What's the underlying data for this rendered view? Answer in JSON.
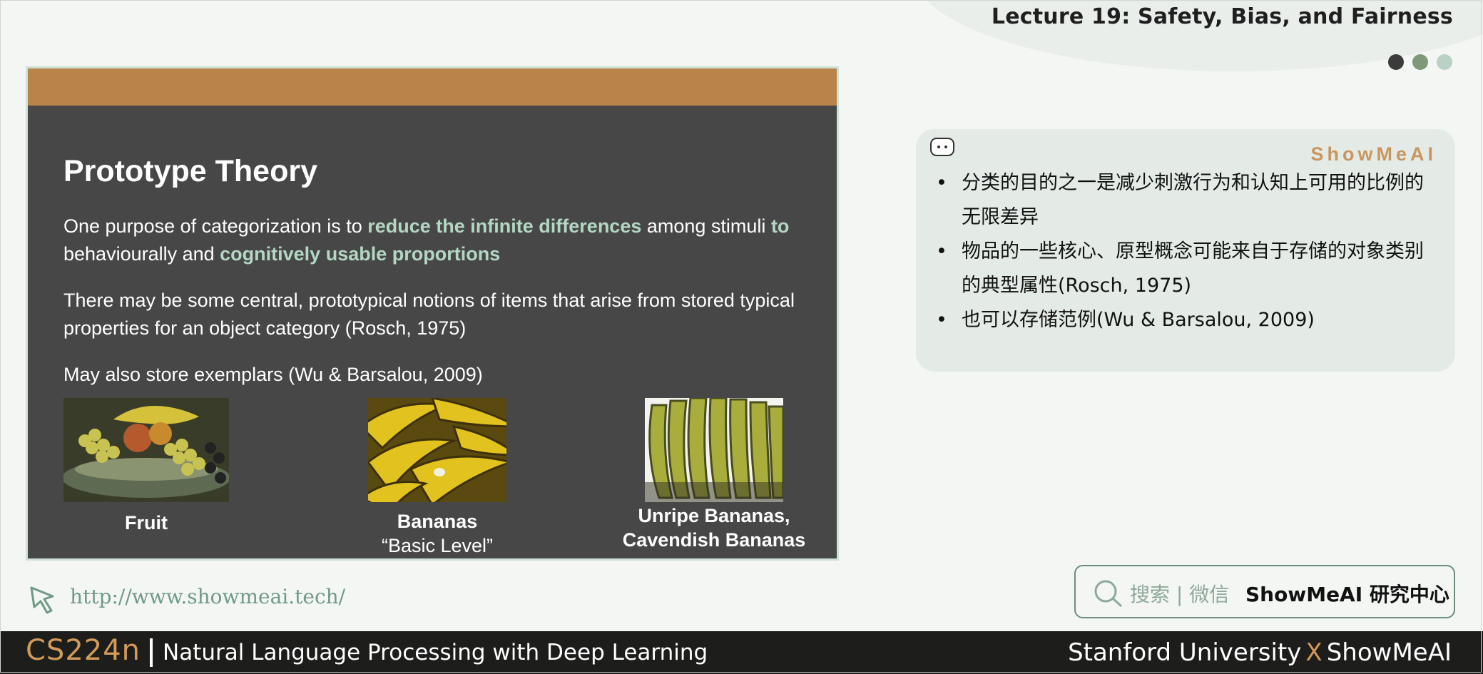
{
  "header": {
    "lecture_title": "Lecture 19: Safety, Bias, and Fairness",
    "dot_colors": [
      "#3b3b3b",
      "#7e9878",
      "#b8d3c5"
    ]
  },
  "slide": {
    "title": "Prototype Theory",
    "p1": {
      "t1": "One purpose of categorization is to ",
      "h1": "reduce the infinite differences",
      "t2": " among stimuli ",
      "h2": "to",
      "t3": " behaviourally and ",
      "h3": "cognitively usable proportions"
    },
    "p2": "There may be some central, prototypical notions of items that arise from stored typical properties for an object category  (Rosch, 1975)",
    "p3": "May also store exemplars (Wu & Barsalou, 2009)",
    "images": [
      {
        "caption_bold": "Fruit",
        "caption_sub": ""
      },
      {
        "caption_bold": "Bananas",
        "caption_sub": "“Basic Level”"
      },
      {
        "caption_bold": "Unripe Bananas,",
        "caption_bold2": "Cavendish Bananas"
      }
    ],
    "colors": {
      "band": "#b9834a",
      "background": "#474747",
      "highlight": "#b4d7c4"
    }
  },
  "note": {
    "brand": "ShowMeAI",
    "bullets": [
      "分类的目的之一是减少刺激行为和认知上可用的比例的无限差异",
      "物品的一些核心、原型概念可能来自于存储的对象类别的典型属性(Rosch, 1975)",
      "也可以存储范例(Wu & Barsalou, 2009)"
    ]
  },
  "link": {
    "url": "http://www.showmeai.tech/"
  },
  "search": {
    "label": "搜索 | 微信",
    "bold": "ShowMeAI 研究中心"
  },
  "footer": {
    "course_code": "CS224n",
    "course_name": "Natural Language Processing with Deep Learning",
    "right_a": "Stanford University",
    "right_x": "X",
    "right_b": "ShowMeAI"
  }
}
